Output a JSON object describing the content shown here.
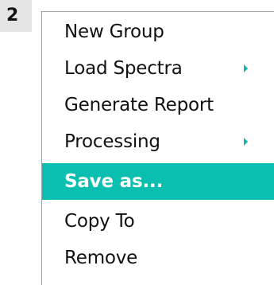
{
  "step_badge": "2",
  "context_menu": {
    "items": [
      {
        "label": "New Group",
        "has_submenu": false,
        "selected": false
      },
      {
        "label": "Load Spectra",
        "has_submenu": true,
        "selected": false
      },
      {
        "label": "Generate Report",
        "has_submenu": false,
        "selected": false
      },
      {
        "label": "Processing",
        "has_submenu": true,
        "selected": false
      },
      {
        "label": "Save as...",
        "has_submenu": false,
        "selected": true
      },
      {
        "label": "Copy To",
        "has_submenu": false,
        "selected": false
      },
      {
        "label": "Remove",
        "has_submenu": false,
        "selected": false
      }
    ],
    "highlight_color": "#0bbfb0",
    "submenu_arrow_color": "#16b3a8",
    "submenu_arrow_icon": "triangle-right-icon"
  }
}
